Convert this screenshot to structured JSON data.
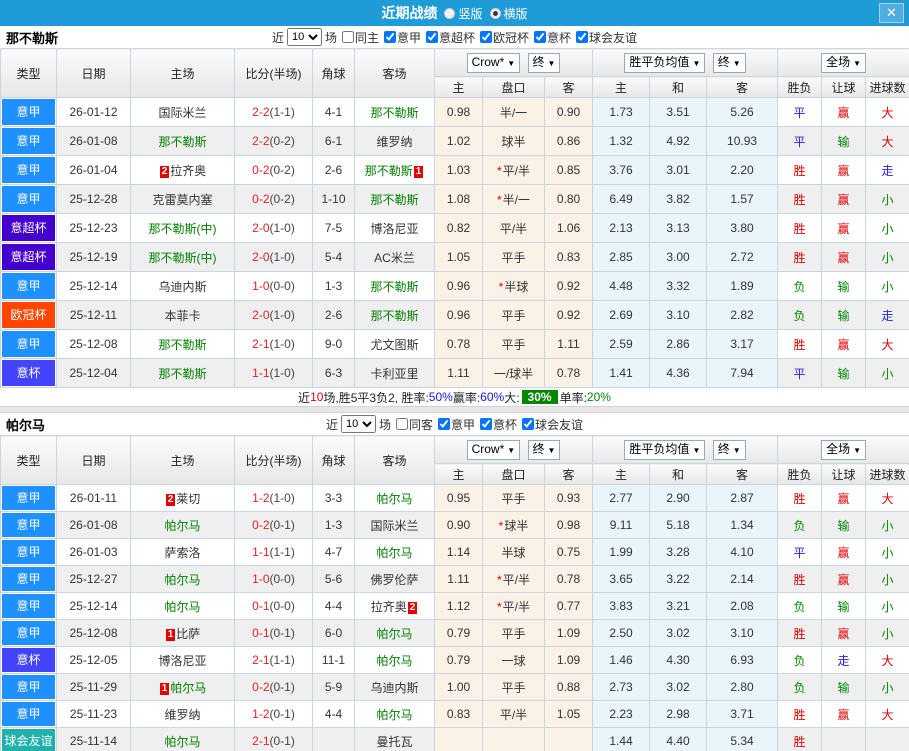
{
  "title_bar": {
    "title": "近期战绩",
    "vertical_label": "竖版",
    "horizontal_label": "横版",
    "vertical_checked": false,
    "horizontal_checked": true,
    "close_label": "✕"
  },
  "colors": {
    "titlebar_bg": "#1F9BD8",
    "league": {
      "意甲": "#1E90FF",
      "意超杯": "#4400CC",
      "欧冠杯": "#FF4500",
      "意杯": "#4444FF",
      "球会友谊": "#20B2AA"
    },
    "result": {
      "胜": "#DD0000",
      "赢": "#DD0000",
      "大": "#DD0000",
      "平": "#2222DD",
      "走": "#2222DD",
      "负": "#008800",
      "输": "#008800",
      "小": "#008800"
    },
    "team_green": "#008000",
    "score_red": "#E62222",
    "card_bg": "#E60000",
    "summary_badge_bg": "#008800"
  },
  "table_header": {
    "type": "类型",
    "date": "日期",
    "home": "主场",
    "score": "比分(半场)",
    "corner": "角球",
    "away": "客场",
    "dd_crow": "Crow*",
    "dd_final": "终",
    "dd_wdl_avg": "胜平负均值",
    "dd_final2": "终",
    "dd_full": "全场",
    "sub": [
      "主",
      "盘口",
      "客",
      "主",
      "和",
      "客",
      "胜负",
      "让球",
      "进球数"
    ]
  },
  "sections": [
    {
      "team": "那不勒斯",
      "filter": {
        "near_label": "近",
        "count": "10",
        "games_label": "场",
        "same_label": "同主",
        "same_checked": false,
        "leagues": [
          {
            "label": "意甲",
            "checked": true
          },
          {
            "label": "意超杯",
            "checked": true
          },
          {
            "label": "欧冠杯",
            "checked": true
          },
          {
            "label": "意杯",
            "checked": true
          },
          {
            "label": "球会友谊",
            "checked": true
          }
        ]
      },
      "rows": [
        {
          "league": "意甲",
          "date": "26-01-12",
          "home": {
            "name": "国际米兰",
            "green": false,
            "card_pre": "",
            "card_post": ""
          },
          "score_ft": "2-2",
          "score_ht": "(1-1)",
          "corner": "4-1",
          "away": {
            "name": "那不勒斯",
            "green": true,
            "card_pre": "",
            "card_post": ""
          },
          "odds_home": "0.98",
          "handicap": "半/一",
          "odds_away": "0.90",
          "avg_home": "1.73",
          "avg_draw": "3.51",
          "avg_away": "5.26",
          "wdl": "平",
          "handicap_res": "赢",
          "goals": "大"
        },
        {
          "league": "意甲",
          "date": "26-01-08",
          "home": {
            "name": "那不勒斯",
            "green": true,
            "card_pre": "",
            "card_post": ""
          },
          "score_ft": "2-2",
          "score_ht": "(0-2)",
          "corner": "6-1",
          "away": {
            "name": "维罗纳",
            "green": false,
            "card_pre": "",
            "card_post": ""
          },
          "odds_home": "1.02",
          "handicap": "球半",
          "odds_away": "0.86",
          "avg_home": "1.32",
          "avg_draw": "4.92",
          "avg_away": "10.93",
          "wdl": "平",
          "handicap_res": "输",
          "goals": "大"
        },
        {
          "league": "意甲",
          "date": "26-01-04",
          "home": {
            "name": "拉齐奥",
            "green": false,
            "card_pre": "2",
            "card_post": ""
          },
          "score_ft": "0-2",
          "score_ht": "(0-2)",
          "corner": "2-6",
          "away": {
            "name": "那不勒斯",
            "green": true,
            "card_pre": "",
            "card_post": "1"
          },
          "odds_home": "1.03",
          "handicap": "*平/半",
          "odds_away": "0.85",
          "avg_home": "3.76",
          "avg_draw": "3.01",
          "avg_away": "2.20",
          "wdl": "胜",
          "handicap_res": "赢",
          "goals": "走"
        },
        {
          "league": "意甲",
          "date": "25-12-28",
          "home": {
            "name": "克雷莫内塞",
            "green": false,
            "card_pre": "",
            "card_post": ""
          },
          "score_ft": "0-2",
          "score_ht": "(0-2)",
          "corner": "1-10",
          "away": {
            "name": "那不勒斯",
            "green": true,
            "card_pre": "",
            "card_post": ""
          },
          "odds_home": "1.08",
          "handicap": "*半/一",
          "odds_away": "0.80",
          "avg_home": "6.49",
          "avg_draw": "3.82",
          "avg_away": "1.57",
          "wdl": "胜",
          "handicap_res": "赢",
          "goals": "小"
        },
        {
          "league": "意超杯",
          "date": "25-12-23",
          "home": {
            "name": "那不勒斯(中)",
            "green": true,
            "card_pre": "",
            "card_post": ""
          },
          "score_ft": "2-0",
          "score_ht": "(1-0)",
          "corner": "7-5",
          "away": {
            "name": "博洛尼亚",
            "green": false,
            "card_pre": "",
            "card_post": ""
          },
          "odds_home": "0.82",
          "handicap": "平/半",
          "odds_away": "1.06",
          "avg_home": "2.13",
          "avg_draw": "3.13",
          "avg_away": "3.80",
          "wdl": "胜",
          "handicap_res": "赢",
          "goals": "小"
        },
        {
          "league": "意超杯",
          "date": "25-12-19",
          "home": {
            "name": "那不勒斯(中)",
            "green": true,
            "card_pre": "",
            "card_post": ""
          },
          "score_ft": "2-0",
          "score_ht": "(1-0)",
          "corner": "5-4",
          "away": {
            "name": "AC米兰",
            "green": false,
            "card_pre": "",
            "card_post": ""
          },
          "odds_home": "1.05",
          "handicap": "平手",
          "odds_away": "0.83",
          "avg_home": "2.85",
          "avg_draw": "3.00",
          "avg_away": "2.72",
          "wdl": "胜",
          "handicap_res": "赢",
          "goals": "小"
        },
        {
          "league": "意甲",
          "date": "25-12-14",
          "home": {
            "name": "乌迪内斯",
            "green": false,
            "card_pre": "",
            "card_post": ""
          },
          "score_ft": "1-0",
          "score_ht": "(0-0)",
          "corner": "1-3",
          "away": {
            "name": "那不勒斯",
            "green": true,
            "card_pre": "",
            "card_post": ""
          },
          "odds_home": "0.96",
          "handicap": "*半球",
          "odds_away": "0.92",
          "avg_home": "4.48",
          "avg_draw": "3.32",
          "avg_away": "1.89",
          "wdl": "负",
          "handicap_res": "输",
          "goals": "小"
        },
        {
          "league": "欧冠杯",
          "date": "25-12-11",
          "home": {
            "name": "本菲卡",
            "green": false,
            "card_pre": "",
            "card_post": ""
          },
          "score_ft": "2-0",
          "score_ht": "(1-0)",
          "corner": "2-6",
          "away": {
            "name": "那不勒斯",
            "green": true,
            "card_pre": "",
            "card_post": ""
          },
          "odds_home": "0.96",
          "handicap": "平手",
          "odds_away": "0.92",
          "avg_home": "2.69",
          "avg_draw": "3.10",
          "avg_away": "2.82",
          "wdl": "负",
          "handicap_res": "输",
          "goals": "走"
        },
        {
          "league": "意甲",
          "date": "25-12-08",
          "home": {
            "name": "那不勒斯",
            "green": true,
            "card_pre": "",
            "card_post": ""
          },
          "score_ft": "2-1",
          "score_ht": "(1-0)",
          "corner": "9-0",
          "away": {
            "name": "尤文图斯",
            "green": false,
            "card_pre": "",
            "card_post": ""
          },
          "odds_home": "0.78",
          "handicap": "平手",
          "odds_away": "1.11",
          "avg_home": "2.59",
          "avg_draw": "2.86",
          "avg_away": "3.17",
          "wdl": "胜",
          "handicap_res": "赢",
          "goals": "大"
        },
        {
          "league": "意杯",
          "date": "25-12-04",
          "home": {
            "name": "那不勒斯",
            "green": true,
            "card_pre": "",
            "card_post": ""
          },
          "score_ft": "1-1",
          "score_ht": "(1-0)",
          "corner": "6-3",
          "away": {
            "name": "卡利亚里",
            "green": false,
            "card_pre": "",
            "card_post": ""
          },
          "odds_home": "1.11",
          "handicap": "一/球半",
          "odds_away": "0.78",
          "avg_home": "1.41",
          "avg_draw": "4.36",
          "avg_away": "7.94",
          "wdl": "平",
          "handicap_res": "输",
          "goals": "小"
        }
      ],
      "summary": [
        {
          "text": "近",
          "style": "plain"
        },
        {
          "text": "10",
          "style": "red"
        },
        {
          "text": "场,胜5平3负2, 胜率:",
          "style": "plain"
        },
        {
          "text": "50%",
          "style": "blue"
        },
        {
          "text": " 赢率:",
          "style": "plain"
        },
        {
          "text": "60%",
          "style": "blue"
        },
        {
          "text": " 大:",
          "style": "plain"
        },
        {
          "text": "30%",
          "style": "badge"
        },
        {
          "text": " 单率:",
          "style": "plain"
        },
        {
          "text": "20%",
          "style": "green"
        }
      ]
    },
    {
      "team": "帕尔马",
      "filter": {
        "near_label": "近",
        "count": "10",
        "games_label": "场",
        "same_label": "同客",
        "same_checked": false,
        "leagues": [
          {
            "label": "意甲",
            "checked": true
          },
          {
            "label": "意杯",
            "checked": true
          },
          {
            "label": "球会友谊",
            "checked": true
          }
        ]
      },
      "rows": [
        {
          "league": "意甲",
          "date": "26-01-11",
          "home": {
            "name": "莱切",
            "green": false,
            "card_pre": "2",
            "card_post": ""
          },
          "score_ft": "1-2",
          "score_ht": "(1-0)",
          "corner": "3-3",
          "away": {
            "name": "帕尔马",
            "green": true,
            "card_pre": "",
            "card_post": ""
          },
          "odds_home": "0.95",
          "handicap": "平手",
          "odds_away": "0.93",
          "avg_home": "2.77",
          "avg_draw": "2.90",
          "avg_away": "2.87",
          "wdl": "胜",
          "handicap_res": "赢",
          "goals": "大"
        },
        {
          "league": "意甲",
          "date": "26-01-08",
          "home": {
            "name": "帕尔马",
            "green": true,
            "card_pre": "",
            "card_post": ""
          },
          "score_ft": "0-2",
          "score_ht": "(0-1)",
          "corner": "1-3",
          "away": {
            "name": "国际米兰",
            "green": false,
            "card_pre": "",
            "card_post": ""
          },
          "odds_home": "0.90",
          "handicap": "*球半",
          "odds_away": "0.98",
          "avg_home": "9.11",
          "avg_draw": "5.18",
          "avg_away": "1.34",
          "wdl": "负",
          "handicap_res": "输",
          "goals": "小"
        },
        {
          "league": "意甲",
          "date": "26-01-03",
          "home": {
            "name": "萨索洛",
            "green": false,
            "card_pre": "",
            "card_post": ""
          },
          "score_ft": "1-1",
          "score_ht": "(1-1)",
          "corner": "4-7",
          "away": {
            "name": "帕尔马",
            "green": true,
            "card_pre": "",
            "card_post": ""
          },
          "odds_home": "1.14",
          "handicap": "半球",
          "odds_away": "0.75",
          "avg_home": "1.99",
          "avg_draw": "3.28",
          "avg_away": "4.10",
          "wdl": "平",
          "handicap_res": "赢",
          "goals": "小"
        },
        {
          "league": "意甲",
          "date": "25-12-27",
          "home": {
            "name": "帕尔马",
            "green": true,
            "card_pre": "",
            "card_post": ""
          },
          "score_ft": "1-0",
          "score_ht": "(0-0)",
          "corner": "5-6",
          "away": {
            "name": "佛罗伦萨",
            "green": false,
            "card_pre": "",
            "card_post": ""
          },
          "odds_home": "1.11",
          "handicap": "*平/半",
          "odds_away": "0.78",
          "avg_home": "3.65",
          "avg_draw": "3.22",
          "avg_away": "2.14",
          "wdl": "胜",
          "handicap_res": "赢",
          "goals": "小"
        },
        {
          "league": "意甲",
          "date": "25-12-14",
          "home": {
            "name": "帕尔马",
            "green": true,
            "card_pre": "",
            "card_post": ""
          },
          "score_ft": "0-1",
          "score_ht": "(0-0)",
          "corner": "4-4",
          "away": {
            "name": "拉齐奥",
            "green": false,
            "card_pre": "",
            "card_post": "2"
          },
          "odds_home": "1.12",
          "handicap": "*平/半",
          "odds_away": "0.77",
          "avg_home": "3.83",
          "avg_draw": "3.21",
          "avg_away": "2.08",
          "wdl": "负",
          "handicap_res": "输",
          "goals": "小"
        },
        {
          "league": "意甲",
          "date": "25-12-08",
          "home": {
            "name": "比萨",
            "green": false,
            "card_pre": "1",
            "card_post": ""
          },
          "score_ft": "0-1",
          "score_ht": "(0-1)",
          "corner": "6-0",
          "away": {
            "name": "帕尔马",
            "green": true,
            "card_pre": "",
            "card_post": ""
          },
          "odds_home": "0.79",
          "handicap": "平手",
          "odds_away": "1.09",
          "avg_home": "2.50",
          "avg_draw": "3.02",
          "avg_away": "3.10",
          "wdl": "胜",
          "handicap_res": "赢",
          "goals": "小"
        },
        {
          "league": "意杯",
          "date": "25-12-05",
          "home": {
            "name": "博洛尼亚",
            "green": false,
            "card_pre": "",
            "card_post": ""
          },
          "score_ft": "2-1",
          "score_ht": "(1-1)",
          "corner": "11-1",
          "away": {
            "name": "帕尔马",
            "green": true,
            "card_pre": "",
            "card_post": ""
          },
          "odds_home": "0.79",
          "handicap": "一球",
          "odds_away": "1.09",
          "avg_home": "1.46",
          "avg_draw": "4.30",
          "avg_away": "6.93",
          "wdl": "负",
          "handicap_res": "走",
          "goals": "大"
        },
        {
          "league": "意甲",
          "date": "25-11-29",
          "home": {
            "name": "帕尔马",
            "green": true,
            "card_pre": "1",
            "card_post": ""
          },
          "score_ft": "0-2",
          "score_ht": "(0-1)",
          "corner": "5-9",
          "away": {
            "name": "乌迪内斯",
            "green": false,
            "card_pre": "",
            "card_post": ""
          },
          "odds_home": "1.00",
          "handicap": "平手",
          "odds_away": "0.88",
          "avg_home": "2.73",
          "avg_draw": "3.02",
          "avg_away": "2.80",
          "wdl": "负",
          "handicap_res": "输",
          "goals": "小"
        },
        {
          "league": "意甲",
          "date": "25-11-23",
          "home": {
            "name": "维罗纳",
            "green": false,
            "card_pre": "",
            "card_post": ""
          },
          "score_ft": "1-2",
          "score_ht": "(0-1)",
          "corner": "4-4",
          "away": {
            "name": "帕尔马",
            "green": true,
            "card_pre": "",
            "card_post": ""
          },
          "odds_home": "0.83",
          "handicap": "平/半",
          "odds_away": "1.05",
          "avg_home": "2.23",
          "avg_draw": "2.98",
          "avg_away": "3.71",
          "wdl": "胜",
          "handicap_res": "赢",
          "goals": "大"
        },
        {
          "league": "球会友谊",
          "date": "25-11-14",
          "home": {
            "name": "帕尔马",
            "green": true,
            "card_pre": "",
            "card_post": ""
          },
          "score_ft": "2-1",
          "score_ht": "(0-1)",
          "corner": "",
          "away": {
            "name": "曼托瓦",
            "green": false,
            "card_pre": "",
            "card_post": ""
          },
          "odds_home": "",
          "handicap": "",
          "odds_away": "",
          "avg_home": "1.44",
          "avg_draw": "4.40",
          "avg_away": "5.34",
          "wdl": "胜",
          "handicap_res": "",
          "goals": ""
        }
      ],
      "summary": null
    }
  ]
}
